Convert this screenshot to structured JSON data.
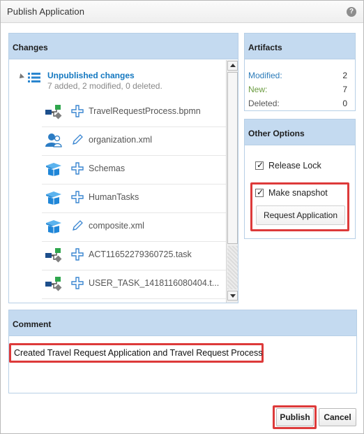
{
  "dialog": {
    "title": "Publish Application",
    "help_icon": "?"
  },
  "changes": {
    "header": "Changes",
    "root": {
      "label": "Unpublished changes",
      "summary": "7 added, 2 modified, 0 deleted."
    },
    "items": [
      {
        "label": "TravelRequestProcess.bpmn",
        "type_icon": "process-icon",
        "action": "added"
      },
      {
        "label": "organization.xml",
        "type_icon": "organization-icon",
        "action": "modified"
      },
      {
        "label": "Schemas",
        "type_icon": "folder-box-icon",
        "action": "added"
      },
      {
        "label": "HumanTasks",
        "type_icon": "folder-box-icon",
        "action": "added"
      },
      {
        "label": "composite.xml",
        "type_icon": "folder-box-icon",
        "action": "modified"
      },
      {
        "label": "ACT11652279360725.task",
        "type_icon": "process-icon",
        "action": "added"
      },
      {
        "label": "USER_TASK_1418116080404.t...",
        "type_icon": "process-icon",
        "action": "added"
      }
    ]
  },
  "artifacts": {
    "header": "Artifacts",
    "rows": [
      {
        "label": "Modified:",
        "value": "2",
        "color": "#2b7bb9"
      },
      {
        "label": "New:",
        "value": "7",
        "color": "#6a9b3f"
      },
      {
        "label": "Deleted:",
        "value": "0",
        "color": "#555555"
      }
    ]
  },
  "options": {
    "header": "Other Options",
    "release_lock": {
      "label": "Release Lock",
      "checked": true
    },
    "make_snapshot": {
      "label": "Make snapshot",
      "checked": true
    },
    "request_application": {
      "value": "Request Application"
    }
  },
  "comment": {
    "header": "Comment",
    "text": "Created Travel Request Application and Travel Request Process"
  },
  "footer": {
    "publish_label": "Publish",
    "cancel_label": "Cancel"
  },
  "colors": {
    "panel_header": "#c4daf0",
    "highlight": "#dd3a3a",
    "link": "#1478c0"
  }
}
